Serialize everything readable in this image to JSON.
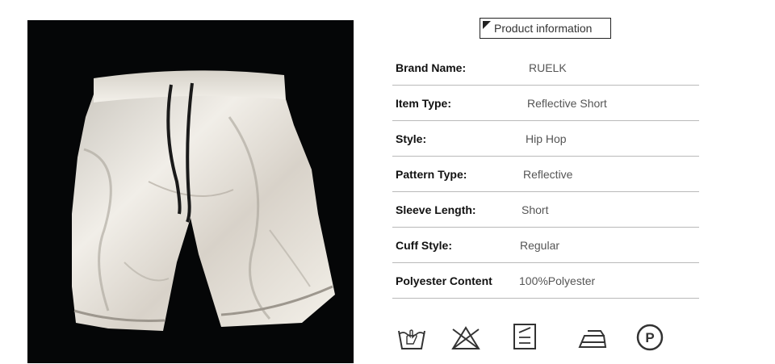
{
  "product_image": {
    "alt": "Reflective shorts product photo",
    "background_color": "#050607",
    "fabric_color": "#e9e6df"
  },
  "info_header": {
    "label": "Product information"
  },
  "specs": [
    {
      "label": "Brand Name:",
      "value": "RUELK"
    },
    {
      "label": "Item Type:",
      "value": "Reflective Short"
    },
    {
      "label": "Style:",
      "value": "Hip Hop"
    },
    {
      "label": "Pattern Type:",
      "value": "Reflective"
    },
    {
      "label": "Sleeve Length:",
      "value": "Short"
    },
    {
      "label": "Cuff Style:",
      "value": "Regular"
    },
    {
      "label": "Polyester Content",
      "value": "100%Polyester"
    }
  ],
  "care_icons": [
    {
      "name": "hand-wash-icon"
    },
    {
      "name": "do-not-bleach-icon"
    },
    {
      "name": "line-dry-icon"
    },
    {
      "name": "iron-low-icon"
    },
    {
      "name": "dry-clean-p-icon"
    }
  ]
}
